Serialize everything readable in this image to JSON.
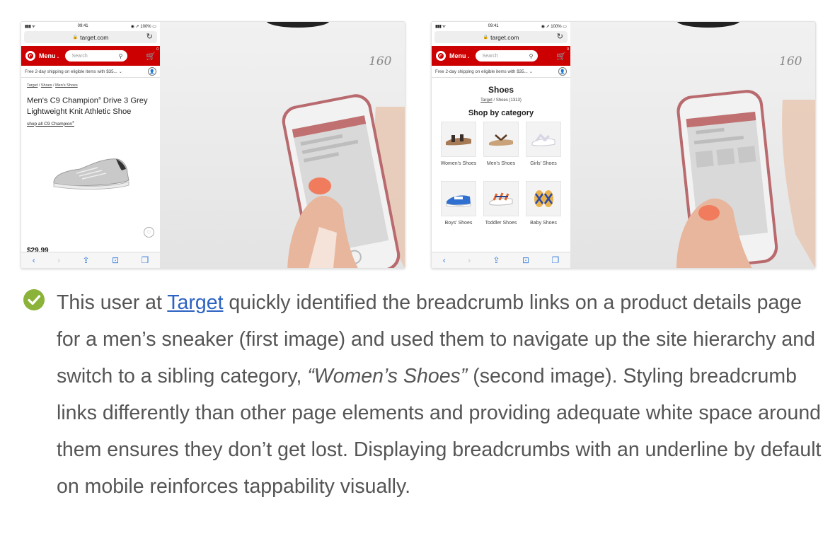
{
  "status": {
    "time": "09:41",
    "battery": "100%"
  },
  "browser": {
    "url": "target.com"
  },
  "store_header": {
    "menu_label": "Menu",
    "search_placeholder": "Search",
    "cart_count": "0"
  },
  "shipping_banner": "Free 2-day shipping on eligible items with $35...",
  "screenshot1": {
    "breadcrumbs": [
      "Target",
      "Shoes",
      "Men's Shoes"
    ],
    "product_title": "Men's C9 Champion",
    "product_title_reg": "®",
    "product_title_rest": " Drive 3 Grey Lightweight Knit Athletic Shoe",
    "shop_all_link": "shop all C9 Champion",
    "shop_all_reg": "®",
    "price": "$29.99"
  },
  "screenshot2": {
    "page_title": "Shoes",
    "breadcrumb_link": "Target",
    "breadcrumb_current": "Shoes (1313)",
    "section_title": "Shop by category",
    "categories": [
      {
        "label": "Women's Shoes",
        "icon": "sandal-icon"
      },
      {
        "label": "Men's Shoes",
        "icon": "flip-flop-icon"
      },
      {
        "label": "Girls' Shoes",
        "icon": "white-sandal-icon"
      },
      {
        "label": "Boys' Shoes",
        "icon": "sneaker-icon"
      },
      {
        "label": "Toddler Shoes",
        "icon": "toddler-sandal-icon"
      },
      {
        "label": "Baby Shoes",
        "icon": "baby-sandal-icon"
      }
    ]
  },
  "photo_note": "160",
  "caption": {
    "part1": "This user at ",
    "link": "Target",
    "part2": " quickly identified the breadcrumb links on a product details page for a men’s sneaker (first image) and used them to navigate up the site hierarchy and switch to a sibling category, ",
    "emphasis": "“Women’s Shoes”",
    "part3": " (second image). Styling breadcrumb links differently than other page elements and providing adequate white space around them ensures they don’t get lost. Displaying breadcrumbs with an underline by default on mobile reinforces tappability visually."
  },
  "colors": {
    "target_red": "#cc0000",
    "check_green": "#8bb33a",
    "link_blue": "#2c62c2",
    "caption_text": "#555555"
  }
}
